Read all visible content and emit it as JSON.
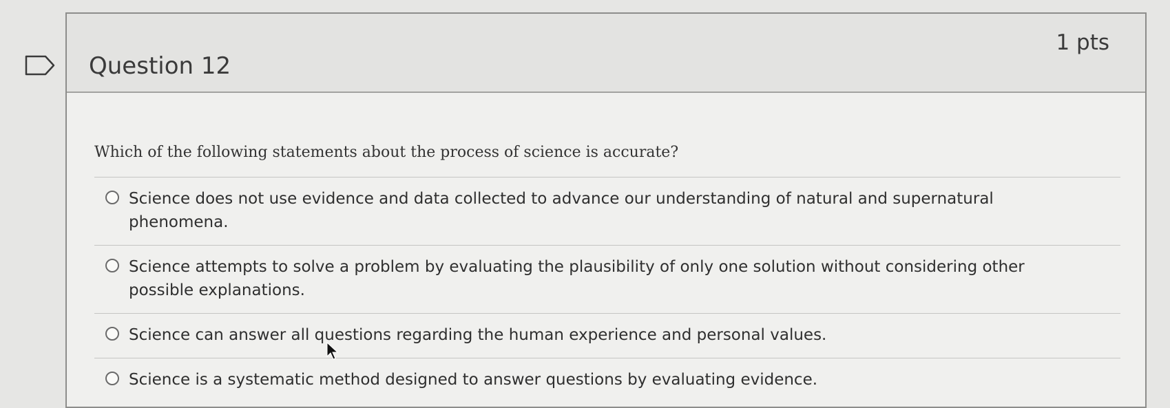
{
  "question": {
    "title": "Question 12",
    "points": "1 pts",
    "prompt": "Which of the following statements about the process of science is accurate?",
    "answers": [
      {
        "label": "Science does not use evidence and data collected to advance our understanding of natural and supernatural phenomena.",
        "selected": false
      },
      {
        "label": "Science attempts to solve a problem by evaluating the plausibility of only one solution without considering other possible explanations.",
        "selected": false
      },
      {
        "label": "Science can answer all questions regarding the human experience and personal values.",
        "selected": false
      },
      {
        "label": "Science is a systematic method designed to answer questions by evaluating evidence.",
        "selected": false
      }
    ]
  },
  "icons": {
    "flag": "flag-outline-icon",
    "cursor": "mouse-pointer-icon"
  },
  "colors": {
    "background": "#e6e6e4",
    "card": "#f0f0ee",
    "header": "#e3e3e1",
    "border": "#8d8d8b",
    "text": "#333333"
  }
}
